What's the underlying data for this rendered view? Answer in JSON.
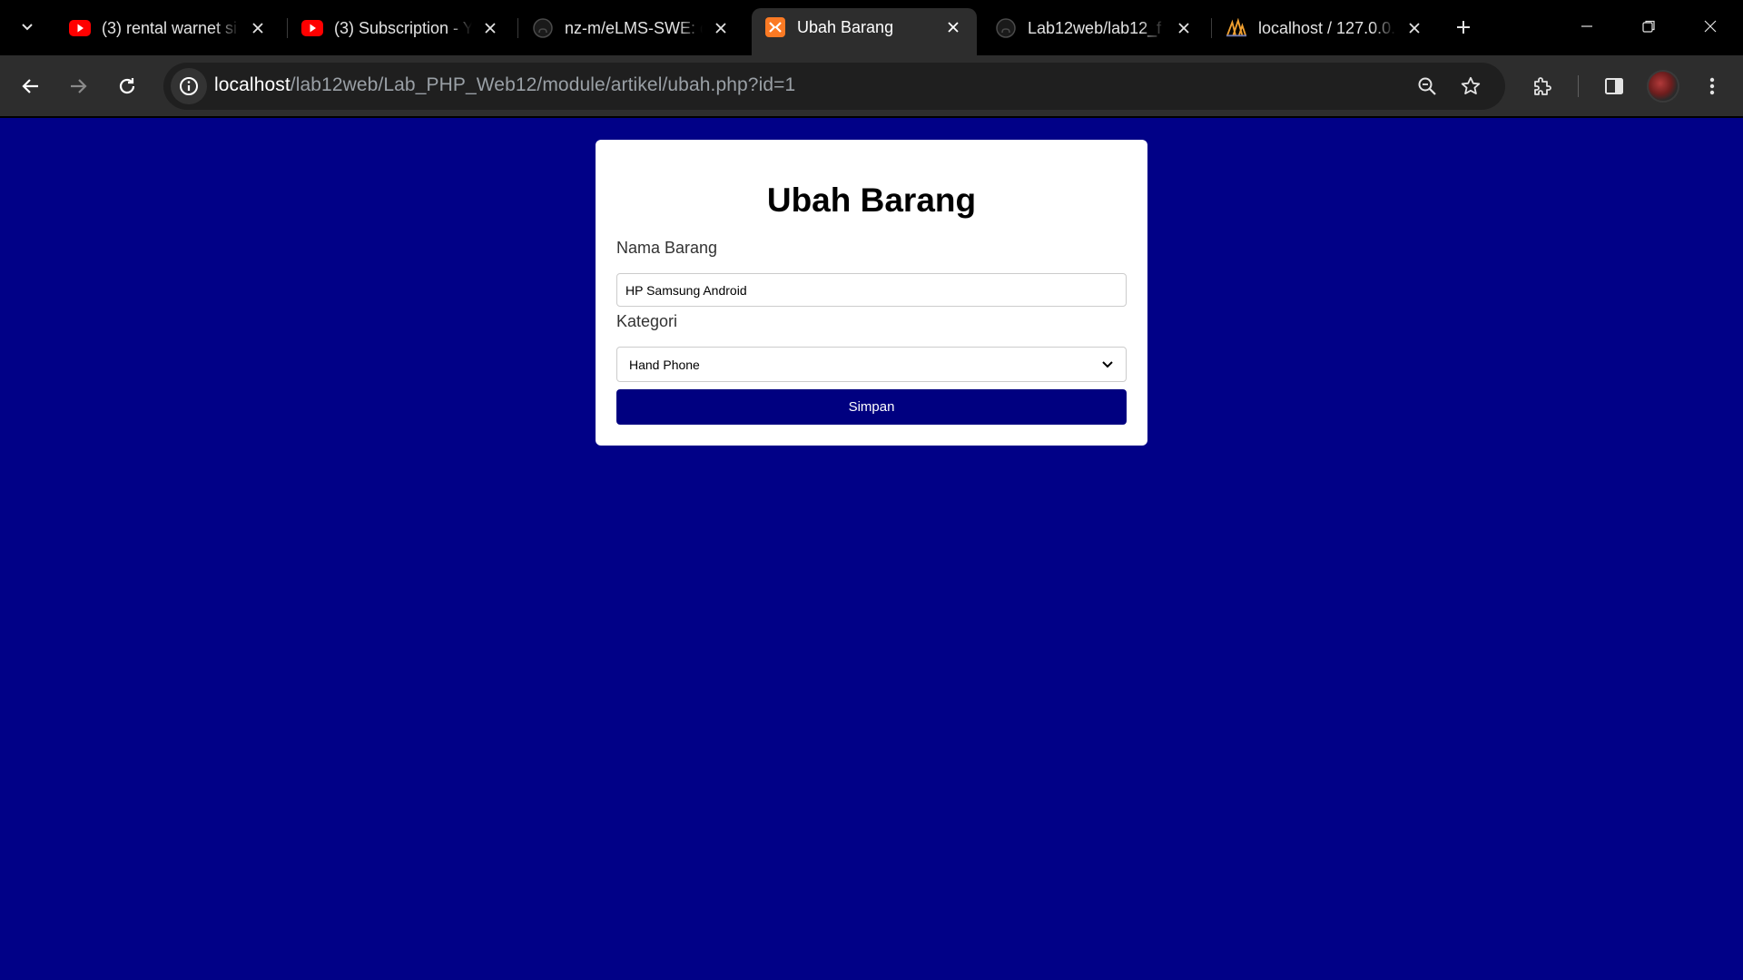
{
  "browser": {
    "tabs": [
      {
        "title": "(3) rental warnet si",
        "icon": "youtube-icon",
        "active": false
      },
      {
        "title": "(3) Subscription - Y",
        "icon": "youtube-icon",
        "active": false
      },
      {
        "title": "nz-m/eLMS-SWE: d",
        "icon": "github-icon",
        "active": false
      },
      {
        "title": "Ubah Barang",
        "icon": "xampp-icon",
        "active": true
      },
      {
        "title": "Lab12web/lab12_f",
        "icon": "github-icon",
        "active": false
      },
      {
        "title": "localhost / 127.0.0.",
        "icon": "phpmyadmin-icon",
        "active": false
      }
    ],
    "url": {
      "host": "localhost",
      "path": "/lab12web/Lab_PHP_Web12/module/artikel/ubah.php?id=1"
    },
    "colors": {
      "youtube_red": "#ff0000",
      "xampp_orange": "#fb7a24",
      "accent": "#000080"
    }
  },
  "page": {
    "background": "#010187",
    "title": "Ubah Barang",
    "form": {
      "nama_label": "Nama Barang",
      "nama_value": "HP Samsung Android",
      "kategori_label": "Kategori",
      "kategori_selected": "Hand Phone",
      "submit_label": "Simpan"
    }
  }
}
